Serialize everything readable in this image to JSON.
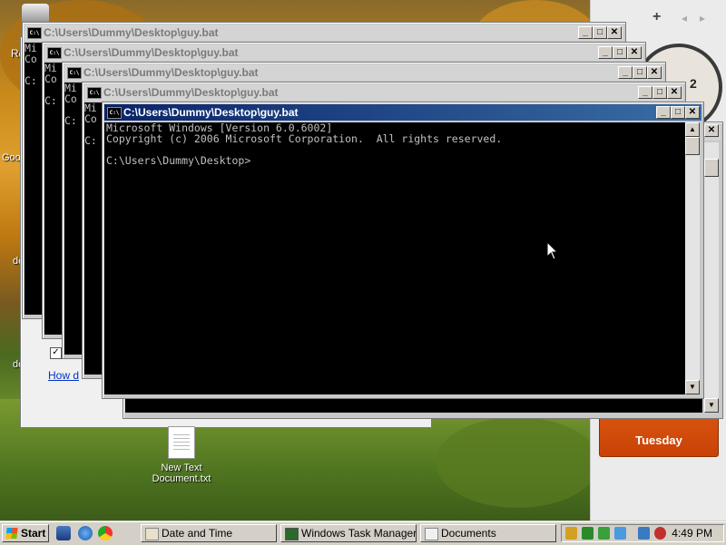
{
  "desktop": {
    "partial_labels": [
      "Re",
      "Goo",
      "de",
      "de"
    ],
    "file_icon": {
      "label": "New Text Document.txt"
    },
    "underlying_link": "How d",
    "checkbox_checked": true
  },
  "sidebar": {
    "add_label": "+",
    "prev_label": "◂",
    "next_label": "▸",
    "clock_number": "2",
    "calendar_day": "Tuesday"
  },
  "windows": [
    {
      "title": "C:\\Users\\Dummy\\Desktop\\guy.bat",
      "lines": [
        "Mi",
        "Co",
        "",
        "C:"
      ]
    },
    {
      "title": "C:\\Users\\Dummy\\Desktop\\guy.bat",
      "lines": [
        "Mi",
        "Co",
        "",
        "C:"
      ]
    },
    {
      "title": "C:\\Users\\Dummy\\Desktop\\guy.bat",
      "lines": [
        "Mi",
        "Co",
        "",
        "C:"
      ]
    },
    {
      "title": "C:\\Users\\Dummy\\Desktop\\guy.bat",
      "lines": [
        "Mi",
        "Co",
        "",
        "C:"
      ]
    },
    {
      "title": "C:\\Users\\Dummy\\Desktop\\guy.bat",
      "lines": [
        "Microsoft Windows [Version 6.0.6002]",
        "Copyright (c) 2006 Microsoft Corporation.  All rights reserved.",
        "",
        "C:\\Users\\Dummy\\Desktop>"
      ]
    }
  ],
  "window_buttons": {
    "minimize": "_",
    "maximize": "□",
    "close": "✕"
  },
  "taskbar": {
    "start_label": "Start",
    "tasks": [
      {
        "label": "Date and Time"
      },
      {
        "label": "Windows Task Manager"
      },
      {
        "label": "Documents"
      }
    ],
    "clock": "4:49 PM"
  },
  "colors": {
    "active_title_start": "#0a246a",
    "active_title_end": "#3a6ea5",
    "calendar": "#d04a0a"
  }
}
